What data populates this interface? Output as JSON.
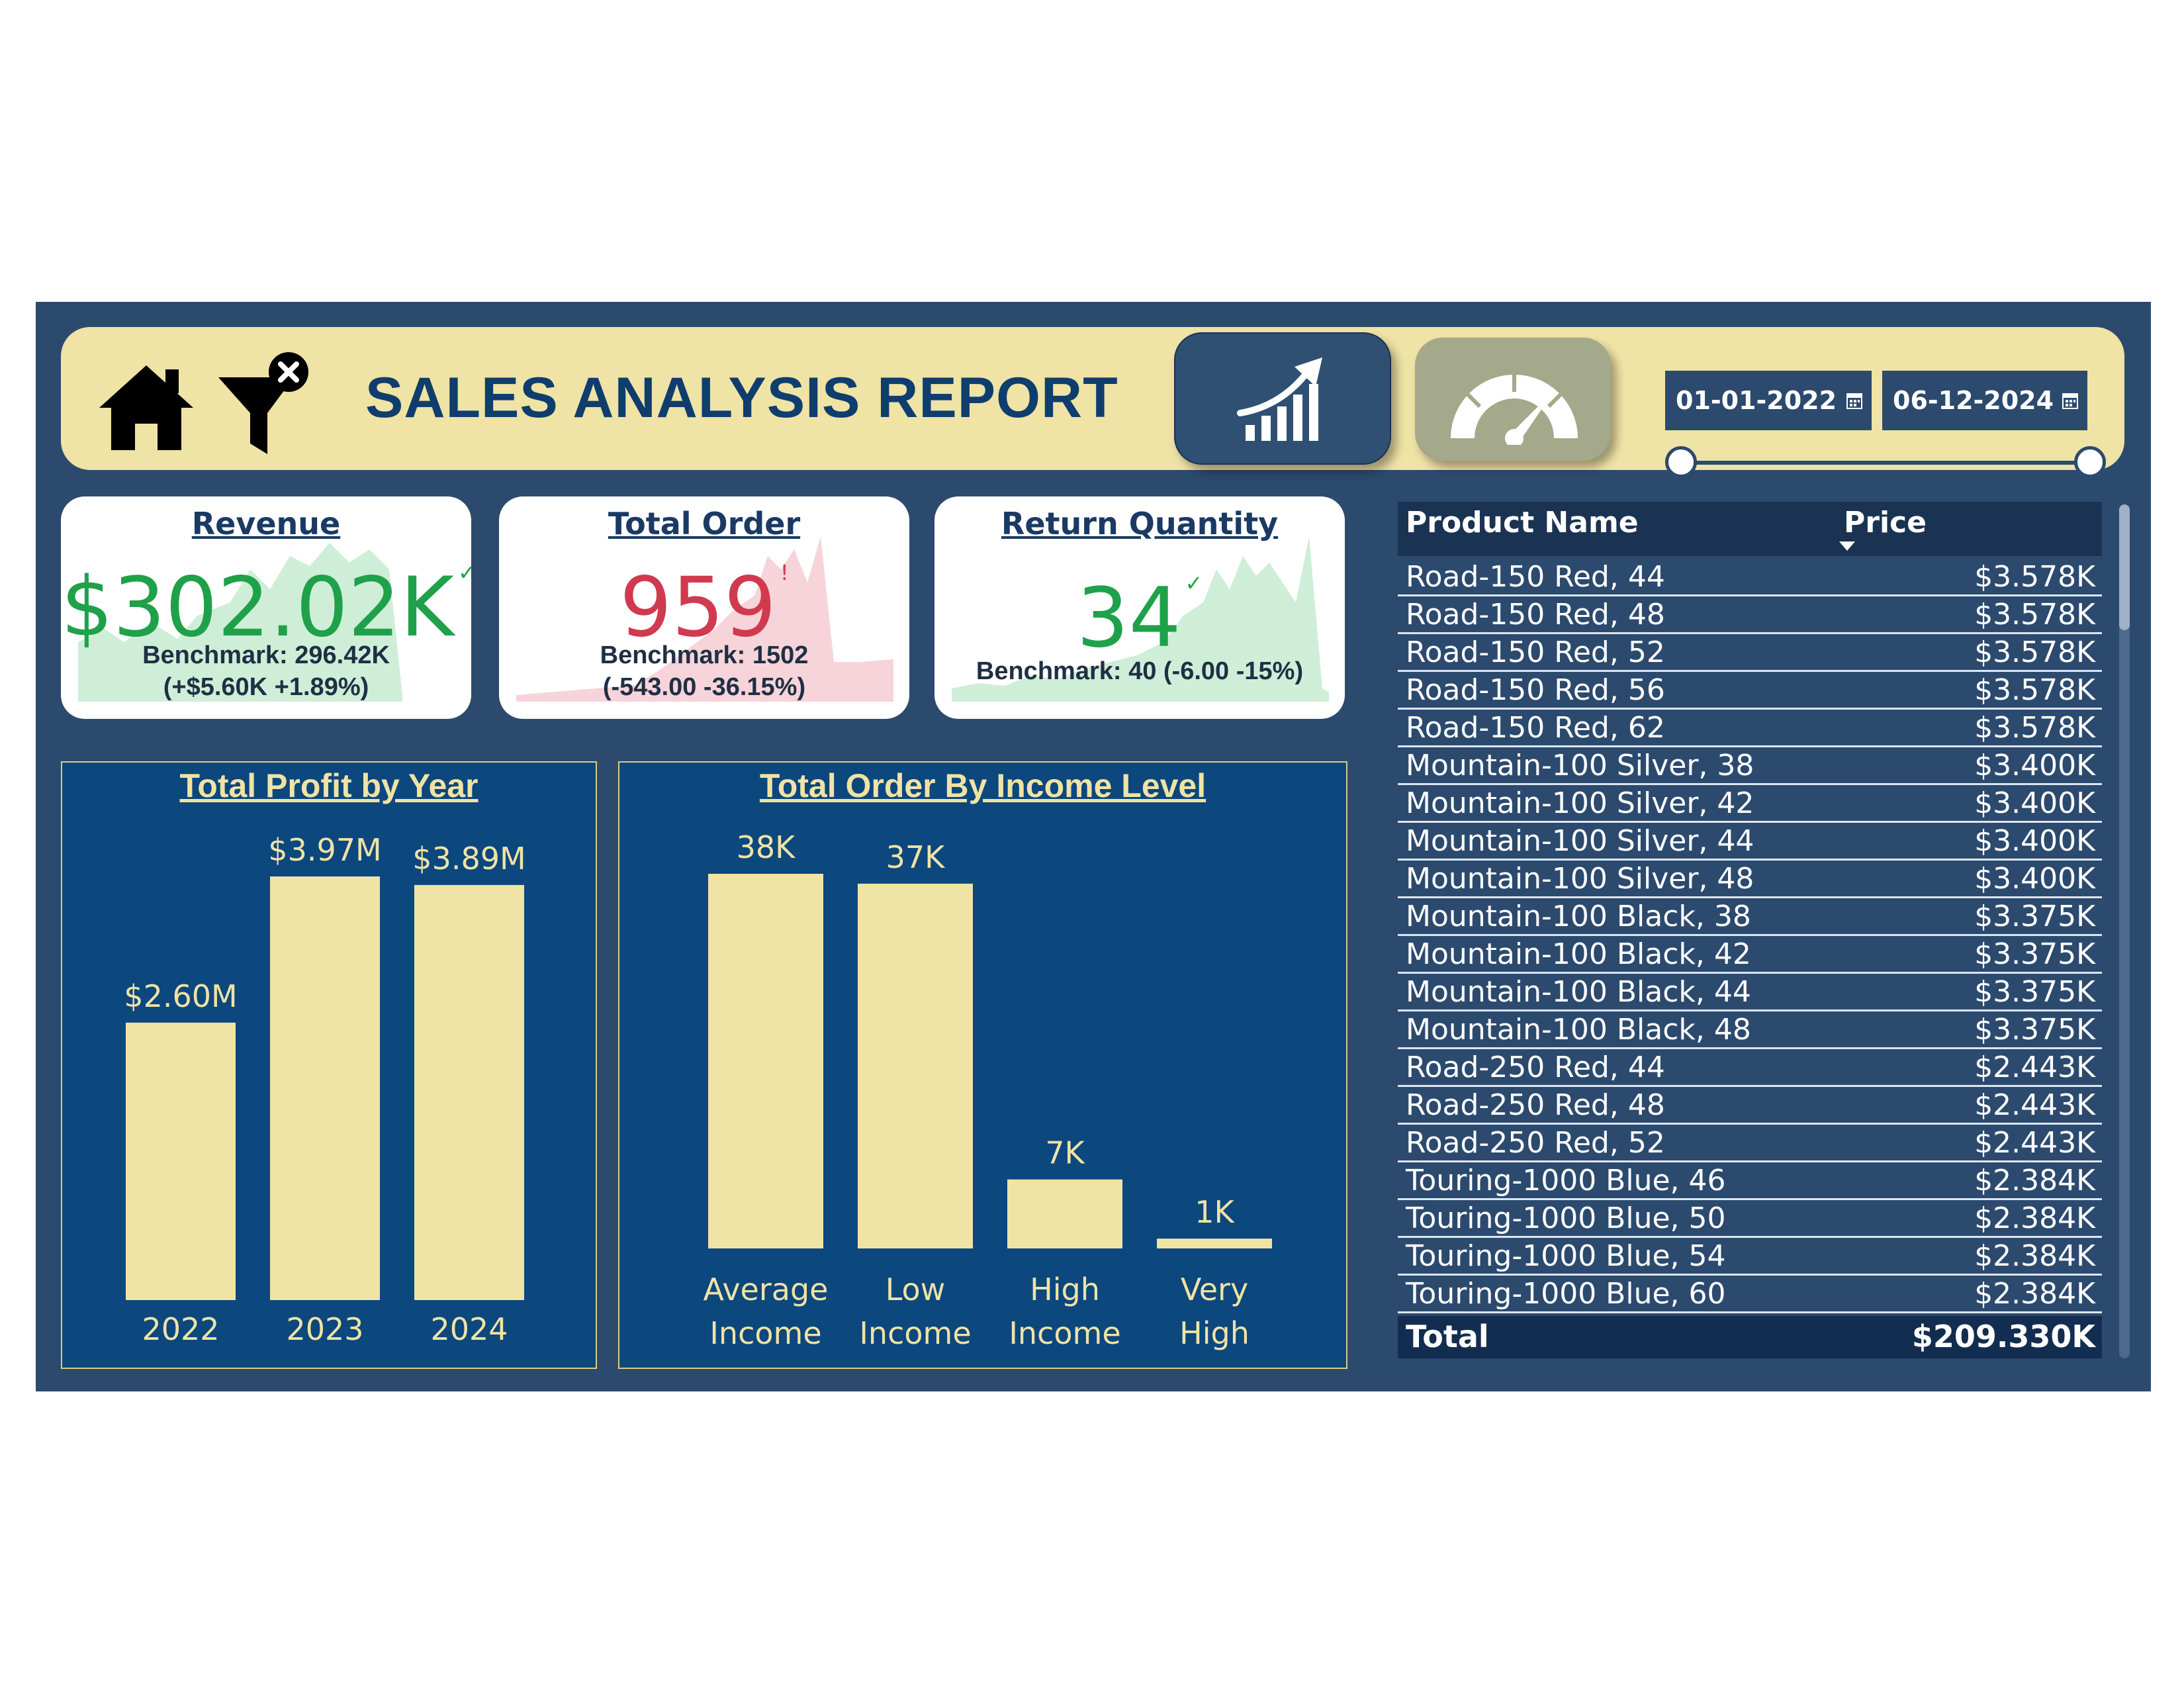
{
  "header": {
    "title": "SALES ANALYSIS REPORT",
    "nav_buttons": [
      {
        "icon": "growth-chart-icon",
        "label": ""
      },
      {
        "icon": "speedometer-icon",
        "label": ""
      }
    ],
    "date_range": {
      "start": "01-01-2022",
      "end": "06-12-2024"
    },
    "icons": [
      "home-icon",
      "clear-filter-icon",
      "calendar-icon"
    ]
  },
  "kpis": [
    {
      "title": "Revenue",
      "value": "$302.02K",
      "status_mark": "✓",
      "color": "#1fa14a",
      "benchmark": "Benchmark: 296.42K",
      "delta": "(+$5.60K +1.89%)",
      "spark_color": "#cfeed8"
    },
    {
      "title": "Total Order",
      "value": "959",
      "status_mark": "!",
      "color": "#d03a4f",
      "benchmark": "Benchmark: 1502",
      "delta": "(-543.00 -36.15%)",
      "spark_color": "#f7d4da"
    },
    {
      "title": "Return Quantity",
      "value": "34",
      "status_mark": "✓",
      "color": "#1fa14a",
      "benchmark": "Benchmark: 40 (-6.00 -15%)",
      "delta": "",
      "spark_color": "#cfeed8"
    }
  ],
  "chart_data": [
    {
      "type": "bar",
      "title": "Total Profit by Year",
      "categories": [
        "2022",
        "2023",
        "2024"
      ],
      "values": [
        2.6,
        3.97,
        3.89
      ],
      "data_labels": [
        "$2.60M",
        "$3.97M",
        "$3.89M"
      ],
      "units": "M",
      "bar_color": "#efe3a5",
      "ylim": [
        0,
        3.97
      ]
    },
    {
      "type": "bar",
      "title": "Total Order By Income Level",
      "categories": [
        [
          "Average",
          "Income"
        ],
        [
          "Low",
          "Income"
        ],
        [
          "High",
          "Income"
        ],
        [
          "Very",
          "High"
        ]
      ],
      "values": [
        38,
        37,
        7,
        1
      ],
      "data_labels": [
        "38K",
        "37K",
        "7K",
        "1K"
      ],
      "units": "K",
      "bar_color": "#efe3a5",
      "ylim": [
        0,
        38
      ]
    }
  ],
  "table": {
    "columns": [
      "Product Name",
      "Price"
    ],
    "rows": [
      [
        "Road-150 Red, 44",
        "$3.578K"
      ],
      [
        "Road-150 Red, 48",
        "$3.578K"
      ],
      [
        "Road-150 Red, 52",
        "$3.578K"
      ],
      [
        "Road-150 Red, 56",
        "$3.578K"
      ],
      [
        "Road-150 Red, 62",
        "$3.578K"
      ],
      [
        "Mountain-100 Silver, 38",
        "$3.400K"
      ],
      [
        "Mountain-100 Silver, 42",
        "$3.400K"
      ],
      [
        "Mountain-100 Silver, 44",
        "$3.400K"
      ],
      [
        "Mountain-100 Silver, 48",
        "$3.400K"
      ],
      [
        "Mountain-100 Black, 38",
        "$3.375K"
      ],
      [
        "Mountain-100 Black, 42",
        "$3.375K"
      ],
      [
        "Mountain-100 Black, 44",
        "$3.375K"
      ],
      [
        "Mountain-100 Black, 48",
        "$3.375K"
      ],
      [
        "Road-250 Red, 44",
        "$2.443K"
      ],
      [
        "Road-250 Red, 48",
        "$2.443K"
      ],
      [
        "Road-250 Red, 52",
        "$2.443K"
      ],
      [
        "Touring-1000 Blue, 46",
        "$2.384K"
      ],
      [
        "Touring-1000 Blue, 50",
        "$2.384K"
      ],
      [
        "Touring-1000 Blue, 54",
        "$2.384K"
      ],
      [
        "Touring-1000 Blue, 60",
        "$2.384K"
      ]
    ],
    "total_label": "Total",
    "total_value": "$209.330K"
  },
  "colors": {
    "background": "#2c4a6e",
    "header": "#efe3a5",
    "title": "#0f3d6e",
    "chart_panel": "#0c477e",
    "bar": "#efe3a5"
  }
}
